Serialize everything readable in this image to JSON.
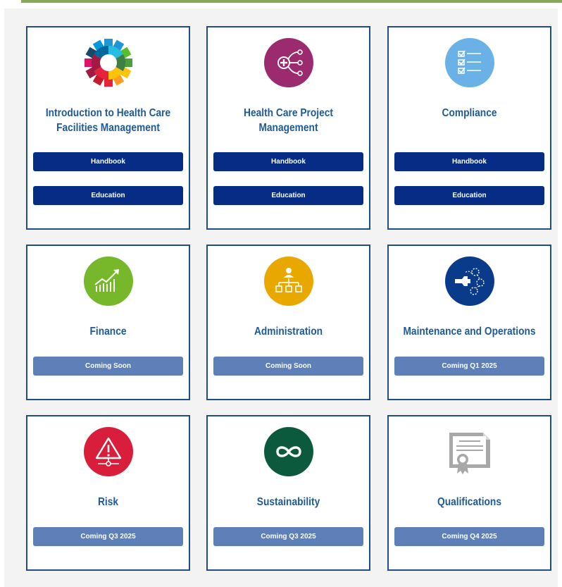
{
  "colors": {
    "accent_bar": "#8aa85a",
    "card_border": "#1d4f86",
    "title_text": "#1f5a97",
    "primary_button": "#072c86",
    "coming_soon_button": "#5f7fb8"
  },
  "cards": [
    {
      "title": "Introduction to Health Care Facilities Management",
      "icon": "gear-puzzle-icon",
      "buttons": [
        "Handbook",
        "Education"
      ]
    },
    {
      "title": "Health Care Project Management",
      "icon": "project-network-icon",
      "icon_color": "#9b2a6f",
      "buttons": [
        "Handbook",
        "Education"
      ]
    },
    {
      "title": "Compliance",
      "icon": "checklist-icon",
      "icon_color": "#69b1e6",
      "buttons": [
        "Handbook",
        "Education"
      ]
    },
    {
      "title": "Finance",
      "icon": "growth-chart-icon",
      "icon_color": "#77b82a",
      "buttons": [
        "Coming Soon"
      ]
    },
    {
      "title": "Administration",
      "icon": "org-chart-icon",
      "icon_color": "#e9a800",
      "buttons": [
        "Coming Soon"
      ]
    },
    {
      "title": "Maintenance and Operations",
      "icon": "wrench-process-icon",
      "icon_color": "#0a3a8a",
      "buttons": [
        "Coming Q1 2025"
      ]
    },
    {
      "title": "Risk",
      "icon": "warning-icon",
      "icon_color": "#d81e3a",
      "buttons": [
        "Coming Q3 2025"
      ]
    },
    {
      "title": "Sustainability",
      "icon": "infinity-icon",
      "icon_color": "#0c5a3e",
      "buttons": [
        "Coming Q3 2025"
      ]
    },
    {
      "title": "Qualifications",
      "icon": "certificate-icon",
      "icon_color": "#a8a8a8",
      "buttons": [
        "Coming Q4 2025"
      ]
    }
  ]
}
